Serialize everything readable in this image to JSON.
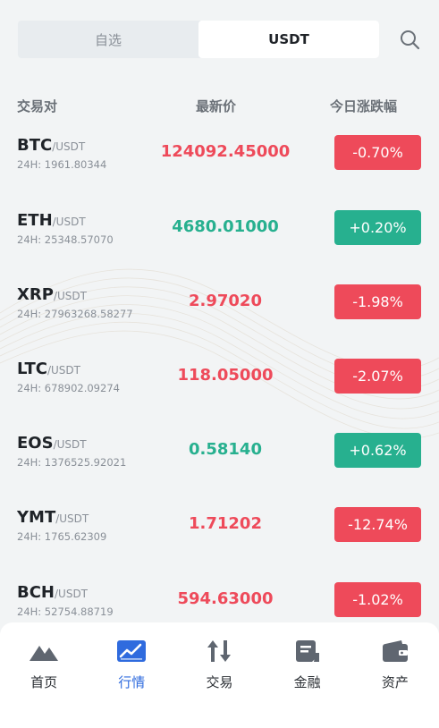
{
  "tabs": [
    {
      "label": "自选",
      "active": false
    },
    {
      "label": "USDT",
      "active": true
    }
  ],
  "header": {
    "pair": "交易对",
    "price": "最新价",
    "change": "今日涨跌幅"
  },
  "rows": [
    {
      "base": "BTC",
      "quote": "/USDT",
      "volume": "24H: 1961.80344",
      "price": "124092.45000",
      "change": "-0.70%",
      "direction": "down"
    },
    {
      "base": "ETH",
      "quote": "/USDT",
      "volume": "24H: 25348.57070",
      "price": "4680.01000",
      "change": "+0.20%",
      "direction": "up"
    },
    {
      "base": "XRP",
      "quote": "/USDT",
      "volume": "24H: 27963268.58277",
      "price": "2.97020",
      "change": "-1.98%",
      "direction": "down"
    },
    {
      "base": "LTC",
      "quote": "/USDT",
      "volume": "24H: 678902.09274",
      "price": "118.05000",
      "change": "-2.07%",
      "direction": "down"
    },
    {
      "base": "EOS",
      "quote": "/USDT",
      "volume": "24H: 1376525.92021",
      "price": "0.58140",
      "change": "+0.62%",
      "direction": "up"
    },
    {
      "base": "YMT",
      "quote": "/USDT",
      "volume": "24H: 1765.62309",
      "price": "1.71202",
      "change": "-12.74%",
      "direction": "down"
    },
    {
      "base": "BCH",
      "quote": "/USDT",
      "volume": "24H: 52754.88719",
      "price": "594.63000",
      "change": "-1.02%",
      "direction": "down"
    }
  ],
  "nav": [
    {
      "label": "首页",
      "icon": "mountain-icon",
      "active": false
    },
    {
      "label": "行情",
      "icon": "chart-icon",
      "active": true
    },
    {
      "label": "交易",
      "icon": "swap-arrows-icon",
      "active": false
    },
    {
      "label": "金融",
      "icon": "document-icon",
      "active": false
    },
    {
      "label": "资产",
      "icon": "wallet-icon",
      "active": false
    }
  ],
  "colors": {
    "up": "#27b08f",
    "down": "#ee4a5a",
    "accent": "#2f6bde"
  }
}
